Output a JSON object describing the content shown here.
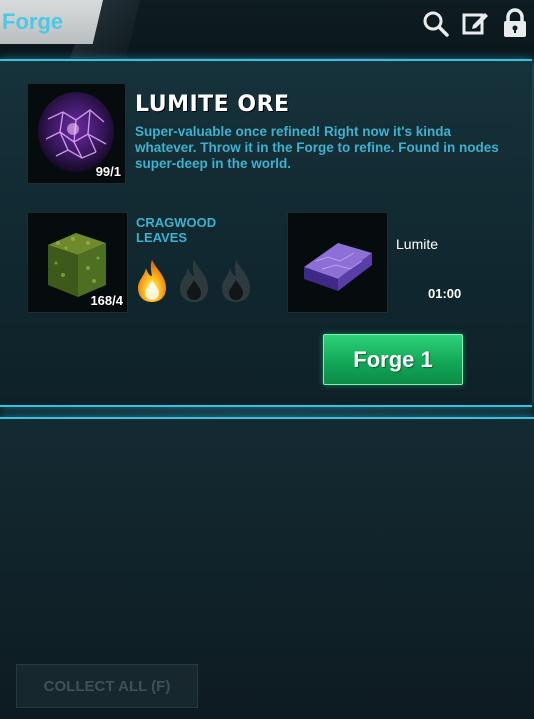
{
  "header": {
    "title": "Forge",
    "icons": [
      "search-icon",
      "edit-icon",
      "lock-icon"
    ],
    "accent_color": "#4cc8e4"
  },
  "recipe": {
    "item_name": "LUMITE ORE",
    "item_count": "99/1",
    "description": "Super-valuable once refined! Right now it's kinda whatever. Throw it in the Forge to refine. Found in nodes super-deep in the world.",
    "resource": {
      "name": "CRAGWOOD LEAVES",
      "count": "168/4"
    },
    "heat_level": 1,
    "heat_max": 3,
    "output": {
      "name": "Lumite",
      "time": "01:00"
    },
    "forge_button": "Forge 1"
  },
  "footer": {
    "collect_button": "COLLECT ALL (F)"
  },
  "colors": {
    "panel_border": "#37c1e4",
    "text_accent": "#3eb1ce",
    "button_green": "#12a858"
  }
}
